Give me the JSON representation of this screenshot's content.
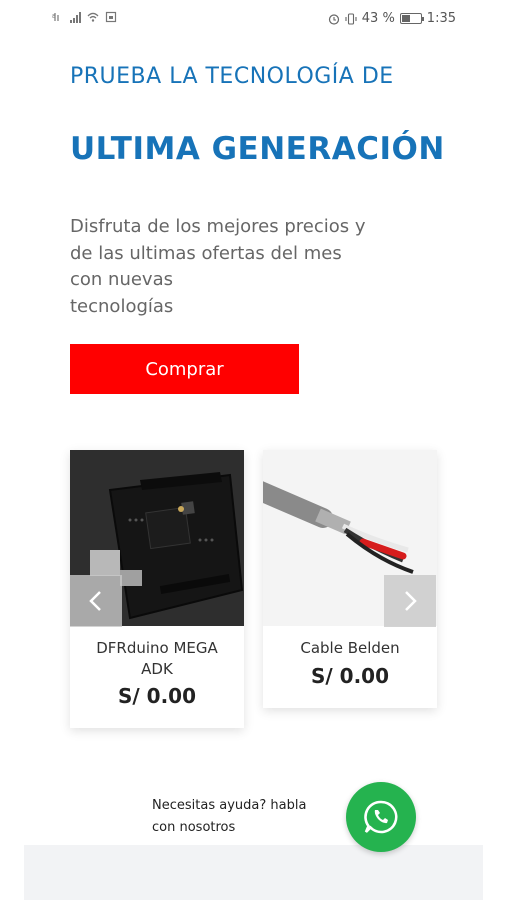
{
  "status_bar": {
    "battery_percent": "43 %",
    "time": "1:35",
    "battery_level": 0.43,
    "icons": [
      "network-icon",
      "signal-icon",
      "wifi-icon",
      "sim-icon",
      "alarm-icon",
      "vibrate-icon",
      "battery-icon"
    ]
  },
  "hero": {
    "pre_title": "PRUEBA LA TECNOLOGÍA DE",
    "title": "ULTIMA GENERACIÓN",
    "description_line1": "Disfruta de los mejores precios y",
    "description_line2": "de las ultimas ofertas del mes",
    "description_line3": "con nuevas",
    "description_line4": "tecnologías",
    "buy_label": "Comprar"
  },
  "products": [
    {
      "name_line1": "DFRduino MEGA",
      "name_line2": "ADK",
      "price": "S/ 0.00"
    },
    {
      "name_line1": "Cable Belden",
      "price": "S/ 0.00"
    }
  ],
  "help": {
    "line1": "Necesitas ayuda? habla",
    "line2": "con nosotros"
  },
  "colors": {
    "accent_blue": "#1773b8",
    "buy_red": "#ff0000",
    "whatsapp_green": "#25b34f"
  }
}
